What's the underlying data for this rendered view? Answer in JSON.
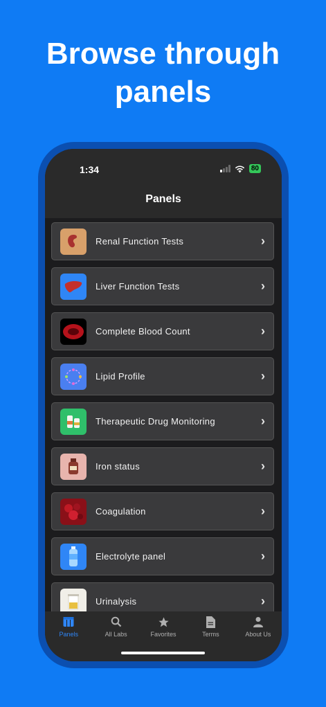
{
  "headline": {
    "line1": "Browse through",
    "line2": "panels"
  },
  "status": {
    "time": "1:34",
    "battery": "80"
  },
  "nav": {
    "title": "Panels"
  },
  "panels": [
    {
      "label": "Renal Function Tests",
      "icon": "kidney-icon",
      "color": "#d8a06a"
    },
    {
      "label": "Liver Function Tests",
      "icon": "liver-icon",
      "color": "#2f86f6"
    },
    {
      "label": "Complete Blood Count",
      "icon": "blood-cell-icon",
      "color": "#000000"
    },
    {
      "label": "Lipid Profile",
      "icon": "lipid-molecule-icon",
      "color": "#4a7ff0"
    },
    {
      "label": "Therapeutic Drug Monitoring",
      "icon": "drug-vials-icon",
      "color": "#2fbf6a"
    },
    {
      "label": "Iron status",
      "icon": "iron-bottle-icon",
      "color": "#e8b4ad"
    },
    {
      "label": "Coagulation",
      "icon": "clot-icon",
      "color": "#8a1018"
    },
    {
      "label": "Electrolyte panel",
      "icon": "water-bottle-icon",
      "color": "#2f86f6"
    },
    {
      "label": "Urinalysis",
      "icon": "urine-sample-icon",
      "color": "#f1efe8"
    }
  ],
  "tabs": [
    {
      "label": "Panels",
      "icon": "panels-icon"
    },
    {
      "label": "All Labs",
      "icon": "search-icon"
    },
    {
      "label": "Favorites",
      "icon": "star-icon"
    },
    {
      "label": "Terms",
      "icon": "document-icon"
    },
    {
      "label": "About Us",
      "icon": "person-icon"
    }
  ],
  "colors": {
    "background": "#0f7bf4",
    "accent": "#2f86f6",
    "battery": "#34c759"
  }
}
